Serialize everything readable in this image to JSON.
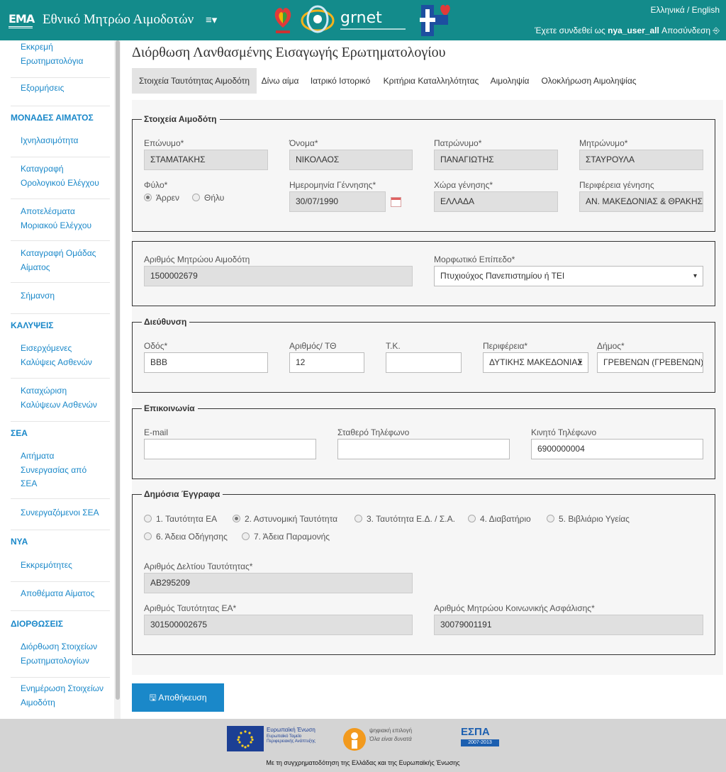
{
  "header": {
    "brand_title": "Εθνικό Μητρώο Αιμοδοτών",
    "brand_logo_text": "ΕΜΑ",
    "menu_toggle": "≡▾",
    "grnet_label": "grnet",
    "language": "Ελληνικά / English",
    "user_prefix": "Έχετε συνδεθεί ως",
    "username": "nya_user_all",
    "logout": "Αποσύνδεση"
  },
  "sidebar": {
    "items": [
      {
        "type": "item",
        "label": "Εκκρεμή Ερωτηματολόγια"
      },
      {
        "type": "item",
        "label": "Εξορμήσεις"
      },
      {
        "type": "section",
        "label": "ΜΟΝΑΔΕΣ ΑΙΜΑΤΟΣ"
      },
      {
        "type": "item",
        "label": "Ιχνηλασιμότητα"
      },
      {
        "type": "item",
        "label": "Καταγραφή Ορολογικού Ελέγχου"
      },
      {
        "type": "item",
        "label": "Αποτελέσματα Μοριακού Ελέγχου"
      },
      {
        "type": "item",
        "label": "Καταγραφή Ομάδας Αίματος"
      },
      {
        "type": "item",
        "label": "Σήμανση"
      },
      {
        "type": "section",
        "label": "ΚΑΛΥΨΕΙΣ"
      },
      {
        "type": "item",
        "label": "Εισερχόμενες Καλύψεις Ασθενών"
      },
      {
        "type": "item",
        "label": "Καταχώριση Καλύψεων Ασθενών"
      },
      {
        "type": "section",
        "label": "ΣΕΑ"
      },
      {
        "type": "item",
        "label": "Αιτήματα Συνεργασίας από ΣΕΑ"
      },
      {
        "type": "item",
        "label": "Συνεργαζόμενοι ΣΕΑ"
      },
      {
        "type": "section",
        "label": "ΝΥΑ"
      },
      {
        "type": "item",
        "label": "Εκκρεμότητες"
      },
      {
        "type": "item",
        "label": "Αποθέματα Αίματος"
      },
      {
        "type": "section",
        "label": "ΔΙΟΡΘΩΣΕΙΣ"
      },
      {
        "type": "item",
        "label": "Διόρθωση Στοιχείων Ερωτηματολογίων"
      },
      {
        "type": "item",
        "label": "Ενημέρωση Στοιχείων Αιμοδότη"
      }
    ]
  },
  "page": {
    "title": "Διόρθωση Λανθασμένης Εισαγωγής Ερωτηματολογίου",
    "tabs": [
      "Στοιχεία Ταυτότητας Αιμοδότη",
      "Δίνω αίμα",
      "Ιατρικό Ιστορικό",
      "Κριτήρια Καταλληλότητας",
      "Αιμοληψία",
      "Ολοκλήρωση Αιμοληψίας"
    ],
    "active_tab": 0
  },
  "donor": {
    "legend": "Στοιχεία Αιμοδότη",
    "surname_label": "Επώνυμο*",
    "surname": "ΣΤΑΜΑΤΑΚΗΣ",
    "name_label": "Όνομα*",
    "name": "ΝΙΚΟΛΑΟΣ",
    "father_label": "Πατρώνυμο*",
    "father": "ΠΑΝΑΓΙΩΤΗΣ",
    "mother_label": "Μητρώνυμο*",
    "mother": "ΣΤΑΥΡΟΥΛΑ",
    "gender_label": "Φύλο*",
    "gender_male": "Άρρεν",
    "gender_female": "Θήλυ",
    "gender_selected": "male",
    "birthdate_label": "Ημερομηνία Γέννησης*",
    "birthdate": "30/07/1990",
    "birth_country_label": "Χώρα γένησης*",
    "birth_country": "ΕΛΛΑΔΑ",
    "birth_region_label": "Περιφέρεια γένησης",
    "birth_region": "ΑΝ. ΜΑΚΕΔΟΝΙΑΣ & ΘΡΑΚΗΣ"
  },
  "registry": {
    "donor_id_label": "Αριθμός Μητρώου Αιμοδότη",
    "donor_id": "1500002679",
    "education_label": "Μορφωτικό Επίπεδο*",
    "education": "Πτυχιούχος Πανεπιστημίου ή ΤΕΙ"
  },
  "address": {
    "legend": "Διεύθυνση",
    "street_label": "Οδός*",
    "street": "BBB",
    "number_label": "Αριθμός/ ΤΘ",
    "number": "12",
    "postcode_label": "Τ.Κ.",
    "postcode": "",
    "region_label": "Περιφέρεια*",
    "region": "ΔΥΤΙΚΗΣ ΜΑΚΕΔΟΝΙΑΣ",
    "municipality_label": "Δήμος*",
    "municipality": "ΓΡΕΒΕΝΩΝ (ΓΡΕΒΕΝΩΝ)"
  },
  "contact": {
    "legend": "Επικοινωνία",
    "email_label": "E-mail",
    "email": "",
    "landline_label": "Σταθερό Τηλέφωνο",
    "landline": "",
    "mobile_label": "Κινητό Τηλέφωνο",
    "mobile": "6900000004"
  },
  "documents": {
    "legend": "Δημόσια Έγγραφα",
    "options": [
      "1. Ταυτότητα ΕΑ",
      "2. Αστυνομική Ταυτότητα",
      "3. Ταυτότητα Ε.Δ. / Σ.Α.",
      "4. Διαβατήριο",
      "5. Βιβλιάριο Υγείας",
      "6. Άδεια Οδήγησης",
      "7. Άδεια Παραμονής"
    ],
    "selected_option": 1,
    "id_card_label": "Αριθμός Δελτίου Ταυτότητας*",
    "id_card": "AB295209",
    "ea_id_label": "Αριθμός Ταυτότητας ΕΑ*",
    "ea_id": "301500002675",
    "amka_label": "Αριθμός Μητρώου Κοινωνικής Ασφάλισης*",
    "amka": "30079001191"
  },
  "actions": {
    "save_label": "Αποθήκευση"
  },
  "footer": {
    "eu_text": "Ευρωπαϊκή Ένωση",
    "eu_sub": "Ευρωπαϊκό Ταμείο Περιφερειακής Ανάπτυξης",
    "digital_text": "ψηφιακή επιλογή",
    "digital_sub": "Όλα είναι δυνατά",
    "espa_text": "ΕΣΠΑ",
    "espa_years": "2007-2013",
    "cofunding": "Με τη συγχρηματοδότηση της Ελλάδας και της Ευρωπαϊκής Ένωσης"
  },
  "colors": {
    "header_bg": "#138b8b",
    "accent": "#1a88c9",
    "panel_bg": "#f6f6f6",
    "readonly_bg": "#e0e0e0"
  }
}
